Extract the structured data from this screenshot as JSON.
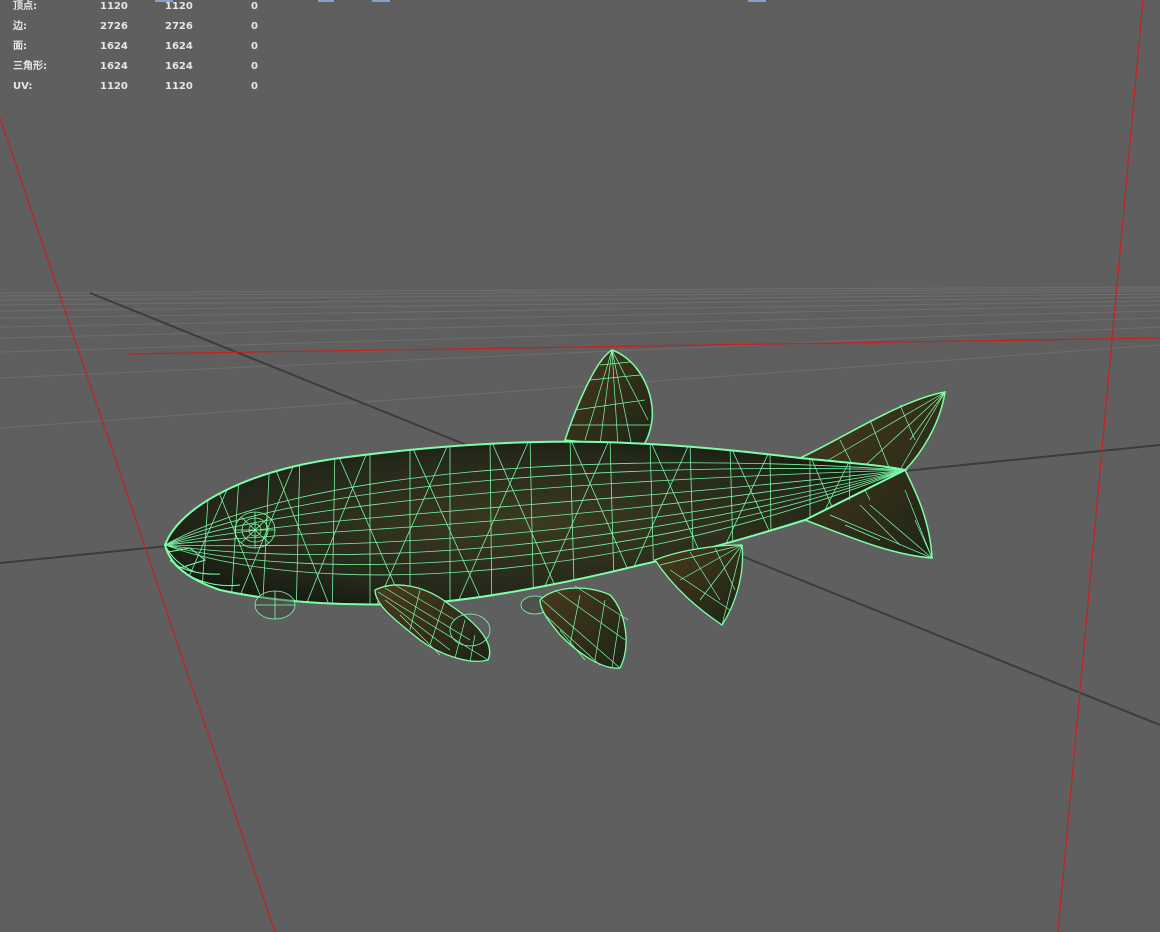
{
  "hud": {
    "rows": [
      {
        "label": "顶点:",
        "a": "1120",
        "b": "1120",
        "c": "0"
      },
      {
        "label": "边:",
        "a": "2726",
        "b": "2726",
        "c": "0"
      },
      {
        "label": "面:",
        "a": "1624",
        "b": "1624",
        "c": "0"
      },
      {
        "label": "三角形:",
        "a": "1624",
        "b": "1624",
        "c": "0"
      },
      {
        "label": "UV:",
        "a": "1120",
        "b": "1120",
        "c": "0"
      }
    ]
  },
  "colors": {
    "background": "#5f5f5f",
    "grid": "#6e6e6e",
    "grid_axis": "#3c3c3c",
    "axis_red": "#c8201e",
    "wireframe": "#7dffaa",
    "fish_fill": "#2a2d1c",
    "hud_text": "#e6e6e6"
  }
}
